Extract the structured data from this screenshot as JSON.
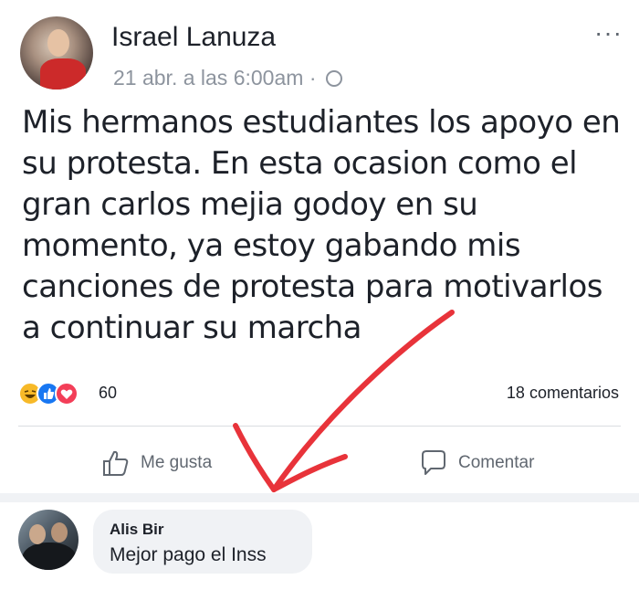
{
  "post": {
    "author": "Israel Lanuza",
    "timestamp": "21 abr. a las 6:00am",
    "separator": "·",
    "privacy_icon": "globe-icon",
    "more_label": "···",
    "text": "Mis hermanos estudiantes los apoyo en su protesta. En esta ocasion como el gran carlos mejia godoy en su momento, ya estoy gabando mis canciones de protesta para motivarlos a continuar su marcha",
    "reaction_count": "60",
    "reactions": [
      "haha",
      "like",
      "love"
    ],
    "comment_count": "18 comentarios"
  },
  "actions": {
    "like_label": "Me gusta",
    "comment_label": "Comentar"
  },
  "comment": {
    "author": "Alis Bir",
    "text": "Mejor pago el Inss"
  },
  "colors": {
    "like_blue": "#1877f2",
    "love_red": "#f33e58",
    "haha_yellow": "#f7b928",
    "annotation_arrow": "#e8333a"
  }
}
